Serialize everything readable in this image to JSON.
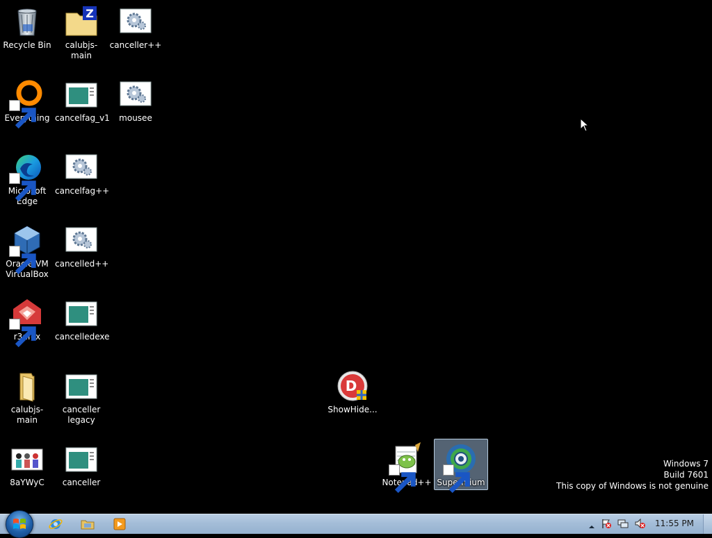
{
  "desktop_icons": [
    {
      "name": "recycle-bin",
      "label": "Recycle Bin",
      "icon": "recycle-bin-icon"
    },
    {
      "name": "calubjs-main-zip",
      "label": "calubjs-main",
      "icon": "zip-folder-icon"
    },
    {
      "name": "canceller-plus",
      "label": "canceller++",
      "icon": "gear-app-icon"
    },
    {
      "name": "everything",
      "label": "Everything",
      "icon": "everything-icon"
    },
    {
      "name": "cancelfag-v1",
      "label": "cancelfag_v1",
      "icon": "window-app-icon"
    },
    {
      "name": "mousee",
      "label": "mousee",
      "icon": "gear-app-icon"
    },
    {
      "name": "microsoft-edge",
      "label": "Microsoft Edge",
      "icon": "edge-icon"
    },
    {
      "name": "cancelfag-plus",
      "label": "cancelfag++",
      "icon": "gear-app-icon"
    },
    {
      "name": "oracle-vm-virtualbox",
      "label": "Oracle VM VirtualBox",
      "icon": "virtualbox-icon"
    },
    {
      "name": "cancelled-plus",
      "label": "cancelled++",
      "icon": "gear-app-icon"
    },
    {
      "name": "r3dfox",
      "label": "r3dfox",
      "icon": "r3dfox-icon"
    },
    {
      "name": "cancelledexe",
      "label": "cancelledexe",
      "icon": "window-app-icon"
    },
    {
      "name": "calubjs-main-folder",
      "label": "calubjs-main",
      "icon": "folder-icon"
    },
    {
      "name": "canceller-legacy",
      "label": "canceller legacy",
      "icon": "window-app-icon"
    },
    {
      "name": "showhide",
      "label": "ShowHide...",
      "icon": "showhide-icon"
    },
    {
      "name": "8aywyc",
      "label": "8aYWyC",
      "icon": "image-icon"
    },
    {
      "name": "canceller",
      "label": "canceller",
      "icon": "window-app-icon"
    },
    {
      "name": "notepad-plus-plus",
      "label": "Notepad++",
      "icon": "notepadpp-icon"
    },
    {
      "name": "supermium",
      "label": "Supermium",
      "icon": "supermium-icon",
      "selected": true
    }
  ],
  "watermark": {
    "line1": "Windows 7",
    "line2": "Build 7601",
    "line3": "This copy of Windows is not genuine"
  },
  "taskbar": {
    "start_icon": "windows-logo-icon",
    "pinned": [
      {
        "name": "internet-explorer",
        "icon": "ie-icon"
      },
      {
        "name": "windows-explorer",
        "icon": "explorer-folder-icon"
      },
      {
        "name": "media-player",
        "icon": "media-player-icon"
      }
    ],
    "tray_icons": [
      "show-hidden-icons-arrow",
      "action-center-flag-icon",
      "network-icon",
      "volume-muted-icon"
    ],
    "clock": "11:55 PM"
  }
}
